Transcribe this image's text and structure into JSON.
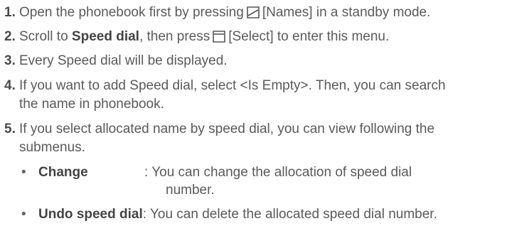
{
  "steps": [
    {
      "num": "1.",
      "pre": "Open the phonebook first by pressing",
      "key": "[Names]",
      "post": "in a standby mode."
    },
    {
      "num": "2.",
      "pre": "Scroll to",
      "bold": "Speed dial",
      "mid": ", then press",
      "key": "[Select]",
      "post": "to enter this menu."
    },
    {
      "num": "3.",
      "text": "Every Speed dial will be displayed."
    },
    {
      "num": "4.",
      "line1": "If you want to add Speed dial, select <Is Empty>. Then, you can search",
      "line2": "the name in phonebook."
    },
    {
      "num": "5.",
      "line1": "If you select allocated name by speed dial, you can view following the",
      "line2": "submenus."
    }
  ],
  "submenus": [
    {
      "bullet": "•",
      "term": "Change",
      "line1": ": You can change the allocation of speed dial",
      "line2": "number."
    },
    {
      "bullet": "•",
      "term": "Undo speed dial",
      "line1": ": You can delete the allocated speed dial number."
    }
  ],
  "icons": {
    "left_softkey": "left-softkey-icon",
    "right_softkey": "right-softkey-icon"
  }
}
